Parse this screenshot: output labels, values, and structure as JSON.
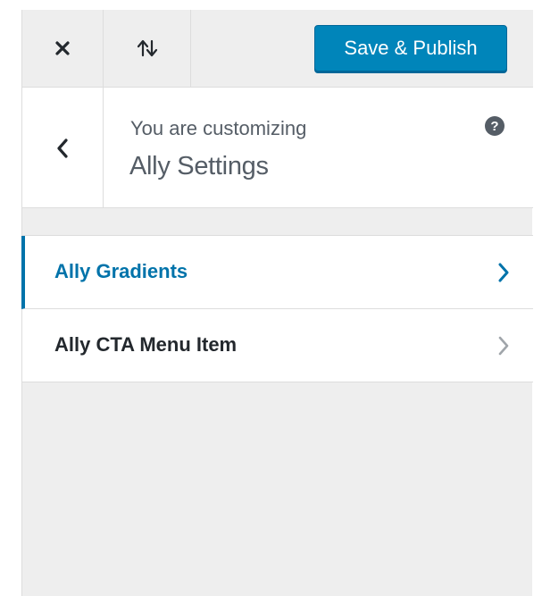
{
  "header": {
    "close_icon": "close-icon",
    "sort_icon": "sort-arrows-icon",
    "publish_label": "Save & Publish"
  },
  "info": {
    "back_icon": "chevron-left-icon",
    "label": "You are customizing",
    "title": "Ally Settings",
    "help_glyph": "?"
  },
  "sections": {
    "items": [
      {
        "label": "Ally Gradients",
        "active": true,
        "icon": "chevron-right-icon"
      },
      {
        "label": "Ally CTA Menu Item",
        "active": false,
        "icon": "chevron-right-icon"
      }
    ]
  },
  "colors": {
    "accent": "#0085ba",
    "active_text": "#0073aa",
    "panel_bg": "#eeeeee",
    "text": "#23282d",
    "muted": "#555d66"
  }
}
